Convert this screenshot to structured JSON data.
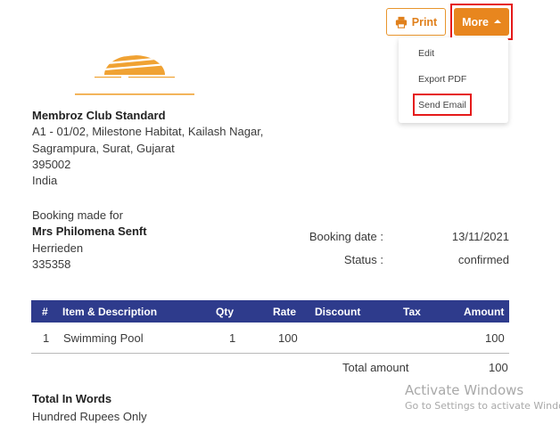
{
  "toolbar": {
    "print_label": "Print",
    "more_label": "More"
  },
  "more_menu": {
    "items": [
      "Edit",
      "Export PDF",
      "Send Email"
    ]
  },
  "company": {
    "name": "Membroz Club Standard",
    "address_line1": "A1 - 01/02, Milestone Habitat, Kailash Nagar,",
    "address_line2": "Sagrampura, Surat, Gujarat",
    "postcode": "395002",
    "country": "India"
  },
  "booking": {
    "intro": "Booking made for",
    "guest_name": "Mrs Philomena Senft",
    "city": "Herrieden",
    "postcode": "335358",
    "date_label": "Booking date :",
    "date_value": "13/11/2021",
    "status_label": "Status :",
    "status_value": "confirmed"
  },
  "table": {
    "headers": [
      "#",
      "Item & Description",
      "Qty",
      "Rate",
      "Discount",
      "Tax",
      "Amount"
    ],
    "rows": [
      [
        "1",
        "Swimming Pool",
        "1",
        "100",
        "",
        "",
        "100"
      ]
    ],
    "header_color": "#2e3b8c"
  },
  "totals": {
    "label": "Total amount",
    "value": "100"
  },
  "words": {
    "title": "Total In Words",
    "value": "Hundred Rupees Only"
  },
  "watermark": {
    "title": "Activate Windows",
    "subtitle": "Go to Settings to activate Window"
  },
  "colors": {
    "accent": "#e8861e",
    "highlight": "#e51a1a"
  }
}
